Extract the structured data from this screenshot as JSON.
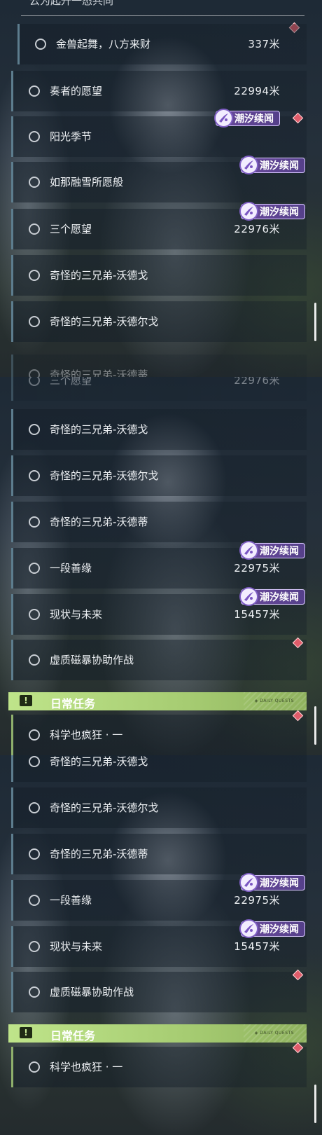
{
  "panel1": {
    "top_partial": "云为起升一态共同",
    "rows": [
      {
        "name": "金兽起舞，八方来财",
        "dist": "337米"
      },
      {
        "name": "奏者的愿望",
        "dist": "22994米"
      },
      {
        "name": "阳光季节",
        "tag": "潮汐续闻"
      },
      {
        "name": "如那融雪所愿般",
        "tag": "潮汐续闻"
      },
      {
        "name": "三个愿望",
        "tag": "潮汐续闻",
        "dist": "22976米"
      },
      {
        "name": "奇怪的三兄弟-沃德戈"
      },
      {
        "name": "奇怪的三兄弟-沃德尔戈"
      },
      {
        "name": "奇怪的三兄弟-沃德蒂"
      }
    ]
  },
  "panel2": {
    "rows": [
      {
        "name": "三个愿望",
        "dist": "22976米"
      },
      {
        "name": "奇怪的三兄弟-沃德戈"
      },
      {
        "name": "奇怪的三兄弟-沃德尔戈"
      },
      {
        "name": "奇怪的三兄弟-沃德蒂"
      },
      {
        "name": "一段善缘",
        "tag": "潮汐续闻",
        "dist": "22975米"
      },
      {
        "name": "现状与未来",
        "tag": "潮汐续闻",
        "dist": "15457米"
      },
      {
        "name": "虚质磁暴协助作战"
      }
    ],
    "section_title": "日常任务",
    "section_sub": "◈ DAILY QUESTS",
    "daily_rows": [
      {
        "name": "科学也疯狂 · 一"
      }
    ]
  },
  "panel3": {
    "rows": [
      {
        "name": "奇怪的三兄弟-沃德戈"
      },
      {
        "name": "奇怪的三兄弟-沃德尔戈"
      },
      {
        "name": "奇怪的三兄弟-沃德蒂"
      },
      {
        "name": "一段善缘",
        "tag": "潮汐续闻",
        "dist": "22975米"
      },
      {
        "name": "现状与未来",
        "tag": "潮汐续闻",
        "dist": "15457米"
      },
      {
        "name": "虚质磁暴协助作战"
      }
    ],
    "section_title": "日常任务",
    "section_sub": "◈ DAILY QUESTS",
    "daily_rows": [
      {
        "name": "科学也疯狂 · 一"
      }
    ]
  },
  "icons": {
    "quest_status": "circle-outline-icon",
    "tag": "tide-emblem-icon",
    "tracked": "diamond-marker-icon",
    "section": "exclamation-icon"
  },
  "colors": {
    "tag_bg": "#6a4a9c",
    "daily_header": "#bfe48a",
    "marker": "#e05c6a"
  }
}
